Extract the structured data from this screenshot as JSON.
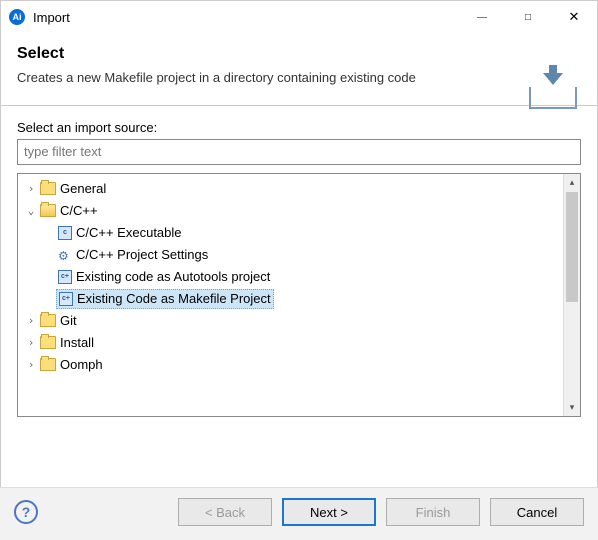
{
  "window": {
    "app_icon_text": "Ai",
    "title": "Import"
  },
  "header": {
    "heading": "Select",
    "description": "Creates a new Makefile project in a directory containing existing code"
  },
  "content": {
    "prompt": "Select an import source:",
    "filter_placeholder": "type filter text"
  },
  "tree": {
    "general": "General",
    "ccpp": "C/C++",
    "ccpp_children": {
      "exec": "C/C++ Executable",
      "settings": "C/C++ Project Settings",
      "autotools": "Existing code as Autotools project",
      "makefile": "Existing Code as Makefile Project"
    },
    "git": "Git",
    "install": "Install",
    "oomph": "Oomph"
  },
  "buttons": {
    "back": "< Back",
    "next": "Next >",
    "finish": "Finish",
    "cancel": "Cancel"
  }
}
